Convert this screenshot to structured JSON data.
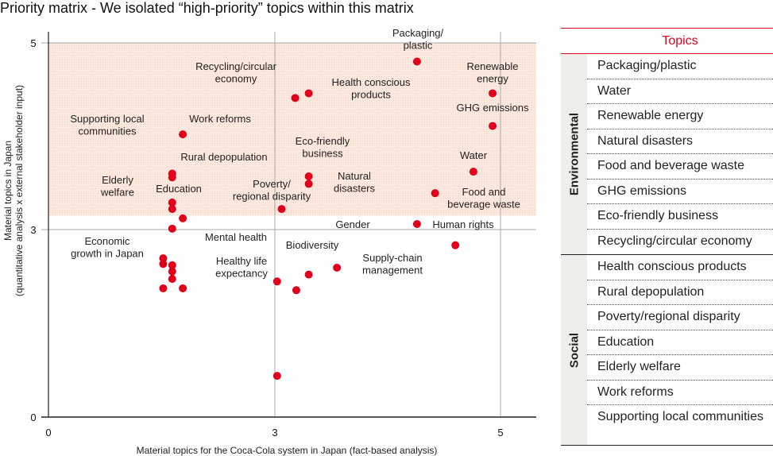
{
  "title": "Priority matrix - We isolated “high-priority” topics within this matrix",
  "chart_data": {
    "type": "scatter",
    "title": "Priority matrix - We isolated “high-priority” topics within this matrix",
    "xlabel": "Material topics for the Coca-Cola system in Japan (fact-based analysis)",
    "ylabel_lines": [
      "Material topics in Japan",
      "(quantitative analysis x external stakeholder input)"
    ],
    "xticks": [
      0,
      3,
      5
    ],
    "yticks": [
      0,
      3,
      5
    ],
    "xlim": [
      0,
      5.3
    ],
    "ylim": [
      0,
      5.1
    ],
    "axis_scale": "piecewise (0–3 and 3–5 drawn at equal length)",
    "grid": true,
    "highlight_region": {
      "label": "high-priority",
      "y_from": 3.15,
      "y_to": 5,
      "color": "#fbe8df"
    },
    "point_color": "#e0001b",
    "points": [
      {
        "x": 4.26,
        "y": 4.8
      },
      {
        "x": 4.93,
        "y": 4.46
      },
      {
        "x": 4.93,
        "y": 4.11
      },
      {
        "x": 4.76,
        "y": 3.62
      },
      {
        "x": 4.42,
        "y": 3.39
      },
      {
        "x": 4.26,
        "y": 3.06
      },
      {
        "x": 4.6,
        "y": 2.75
      },
      {
        "x": 3.18,
        "y": 4.41
      },
      {
        "x": 3.3,
        "y": 4.46
      },
      {
        "x": 3.3,
        "y": 3.57
      },
      {
        "x": 3.3,
        "y": 3.49
      },
      {
        "x": 3.06,
        "y": 3.22
      },
      {
        "x": 3.55,
        "y": 2.39
      },
      {
        "x": 3.3,
        "y": 2.28
      },
      {
        "x": 3.02,
        "y": 2.17
      },
      {
        "x": 3.19,
        "y": 2.03
      },
      {
        "x": 3.02,
        "y": 0.66
      },
      {
        "x": 1.78,
        "y": 4.02
      },
      {
        "x": 1.64,
        "y": 3.6
      },
      {
        "x": 1.64,
        "y": 3.56
      },
      {
        "x": 1.64,
        "y": 3.29
      },
      {
        "x": 1.64,
        "y": 3.22
      },
      {
        "x": 1.78,
        "y": 3.12
      },
      {
        "x": 1.64,
        "y": 3.01
      },
      {
        "x": 1.52,
        "y": 2.54
      },
      {
        "x": 1.52,
        "y": 2.45
      },
      {
        "x": 1.64,
        "y": 2.43
      },
      {
        "x": 1.64,
        "y": 2.33
      },
      {
        "x": 1.64,
        "y": 2.21
      },
      {
        "x": 1.52,
        "y": 2.06
      },
      {
        "x": 1.78,
        "y": 2.06
      }
    ],
    "annotations": [
      [
        "Packaging/",
        "plastic"
      ],
      [
        "Renewable",
        "energy"
      ],
      [
        "GHG emissions"
      ],
      [
        "Recycling/circular",
        "economy"
      ],
      [
        "Health conscious",
        "products"
      ],
      [
        "Supporting local",
        "communities"
      ],
      [
        "Work reforms"
      ],
      [
        "Eco-friendly",
        "business"
      ],
      [
        "Rural depopulation"
      ],
      [
        "Water"
      ],
      [
        "Elderly",
        "welfare"
      ],
      [
        "Education"
      ],
      [
        "Poverty/",
        "regional disparity"
      ],
      [
        "Natural",
        "disasters"
      ],
      [
        "Food and",
        "beverage waste"
      ],
      [
        "Gender"
      ],
      [
        "Human rights"
      ],
      [
        "Economic",
        "growth in Japan"
      ],
      [
        "Mental health"
      ],
      [
        "Biodiversity"
      ],
      [
        "Healthy life",
        "expectancy"
      ],
      [
        "Supply-chain",
        "management"
      ]
    ]
  },
  "table": {
    "header": "Topics",
    "groups": [
      {
        "name": "Environmental",
        "items": [
          "Packaging/plastic",
          "Water",
          "Renewable energy",
          "Natural disasters",
          "Food and beverage waste",
          "GHG emissions",
          "Eco-friendly business",
          "Recycling/circular economy"
        ]
      },
      {
        "name": "Social",
        "items": [
          "Health conscious products",
          "Rural depopulation",
          "Poverty/regional disparity",
          "Education",
          "Elderly welfare",
          "Work reforms",
          "Supporting local communities"
        ]
      }
    ]
  }
}
